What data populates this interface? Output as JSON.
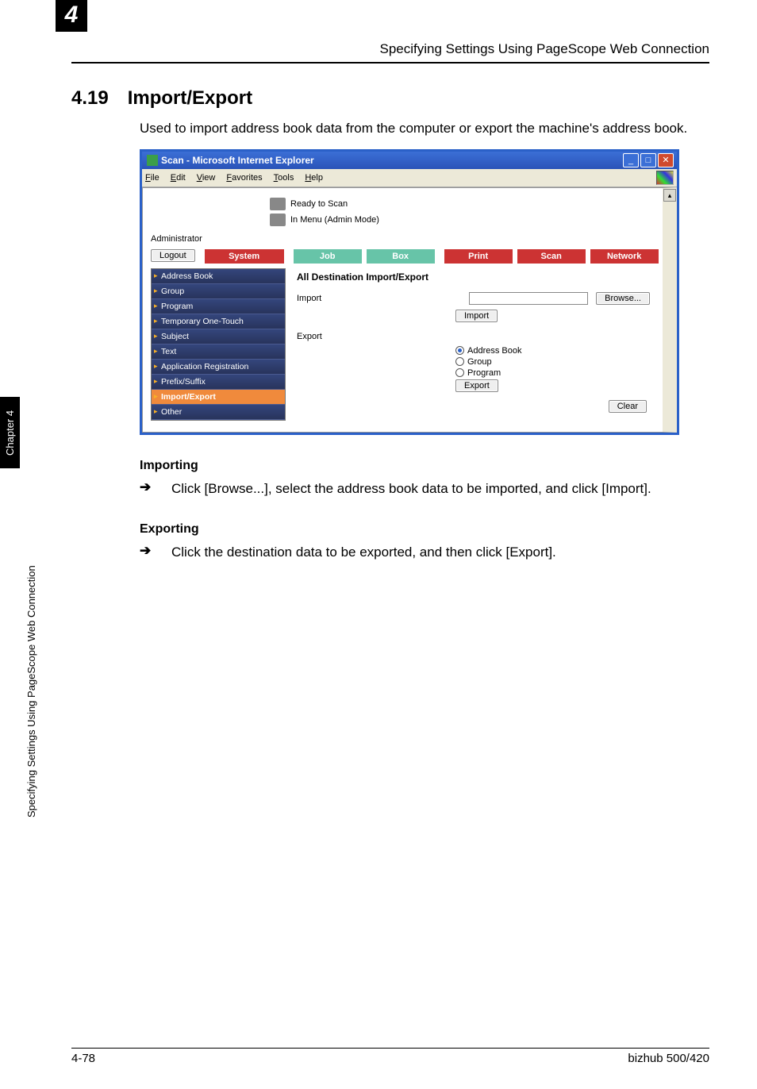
{
  "header": {
    "chapter_num": "4",
    "running_title": "Specifying Settings Using PageScope Web Connection"
  },
  "section": {
    "num": "4.19",
    "title": "Import/Export",
    "intro": "Used to import address book data from the computer or export the machine's address book."
  },
  "screenshot": {
    "titlebar": "Scan - Microsoft Internet Explorer",
    "menus": [
      "File",
      "Edit",
      "View",
      "Favorites",
      "Tools",
      "Help"
    ],
    "status_ready": "Ready to Scan",
    "status_mode": "In Menu (Admin Mode)",
    "admin_label": "Administrator",
    "logout_btn": "Logout",
    "tabs": {
      "system": "System",
      "job": "Job",
      "box": "Box",
      "print": "Print",
      "scan": "Scan",
      "network": "Network"
    },
    "nav": [
      "Address Book",
      "Group",
      "Program",
      "Temporary One-Touch",
      "Subject",
      "Text",
      "Application Registration",
      "Prefix/Suffix",
      "Import/Export",
      "Other"
    ],
    "panel": {
      "heading": "All Destination Import/Export",
      "import_label": "Import",
      "browse_btn": "Browse...",
      "import_btn": "Import",
      "export_label": "Export",
      "radios": [
        "Address Book",
        "Group",
        "Program"
      ],
      "export_btn": "Export",
      "clear_btn": "Clear"
    }
  },
  "importing": {
    "heading": "Importing",
    "step": "Click [Browse...], select the address book data to be imported, and click [Import]."
  },
  "exporting": {
    "heading": "Exporting",
    "step": "Click the destination data to be exported, and then click [Export]."
  },
  "side": {
    "tab": "Chapter 4",
    "label": "Specifying Settings Using PageScope Web Connection"
  },
  "footer": {
    "page": "4-78",
    "model": "bizhub 500/420"
  }
}
